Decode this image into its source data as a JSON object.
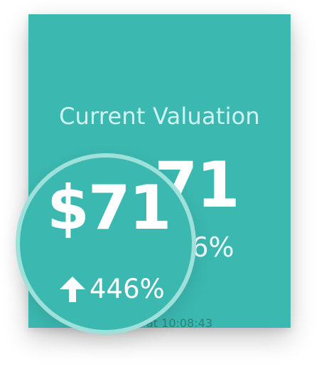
{
  "card": {
    "title": "Current Valuation",
    "value": "$71",
    "change": "446%",
    "subtitle_fragment": "s",
    "timestamp_fragment": "at 10:08:43"
  },
  "magnifier": {
    "value": "$71",
    "change": "446%"
  },
  "icons": {
    "trend": "arrow-up-icon"
  },
  "colors": {
    "card_background": "#3bb8b0",
    "title_text": "#d8f5f2",
    "magnifier_ring": "#9ee0da",
    "value_text": "#ffffff"
  }
}
